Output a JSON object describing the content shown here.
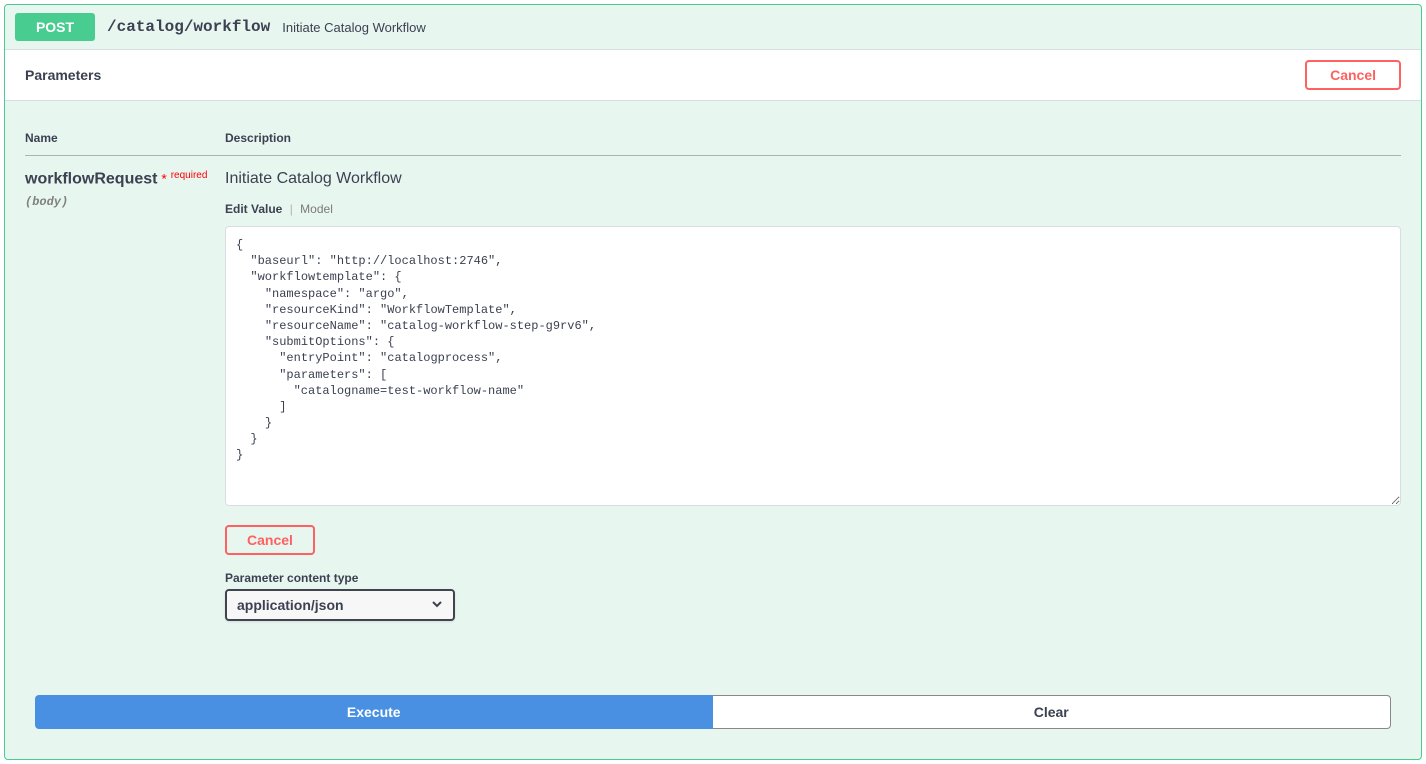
{
  "operation": {
    "method": "POST",
    "path": "/catalog/workflow",
    "summary": "Initiate Catalog Workflow"
  },
  "paramsBar": {
    "title": "Parameters",
    "cancel": "Cancel"
  },
  "table": {
    "nameHeader": "Name",
    "descHeader": "Description"
  },
  "param": {
    "name": "workflowRequest",
    "requiredStar": "*",
    "requiredLabel": "required",
    "in": "(body)",
    "descTitle": "Initiate Catalog Workflow",
    "tabEdit": "Edit Value",
    "tabModel": "Model",
    "body": "{\n  \"baseurl\": \"http://localhost:2746\",\n  \"workflowtemplate\": {\n    \"namespace\": \"argo\",\n    \"resourceKind\": \"WorkflowTemplate\",\n    \"resourceName\": \"catalog-workflow-step-g9rv6\",\n    \"submitOptions\": {\n      \"entryPoint\": \"catalogprocess\",\n      \"parameters\": [\n        \"catalogname=test-workflow-name\"\n      ]\n    }\n  }\n}",
    "cancel": "Cancel",
    "ctLabel": "Parameter content type",
    "ctValue": "application/json"
  },
  "actions": {
    "execute": "Execute",
    "clear": "Clear"
  }
}
